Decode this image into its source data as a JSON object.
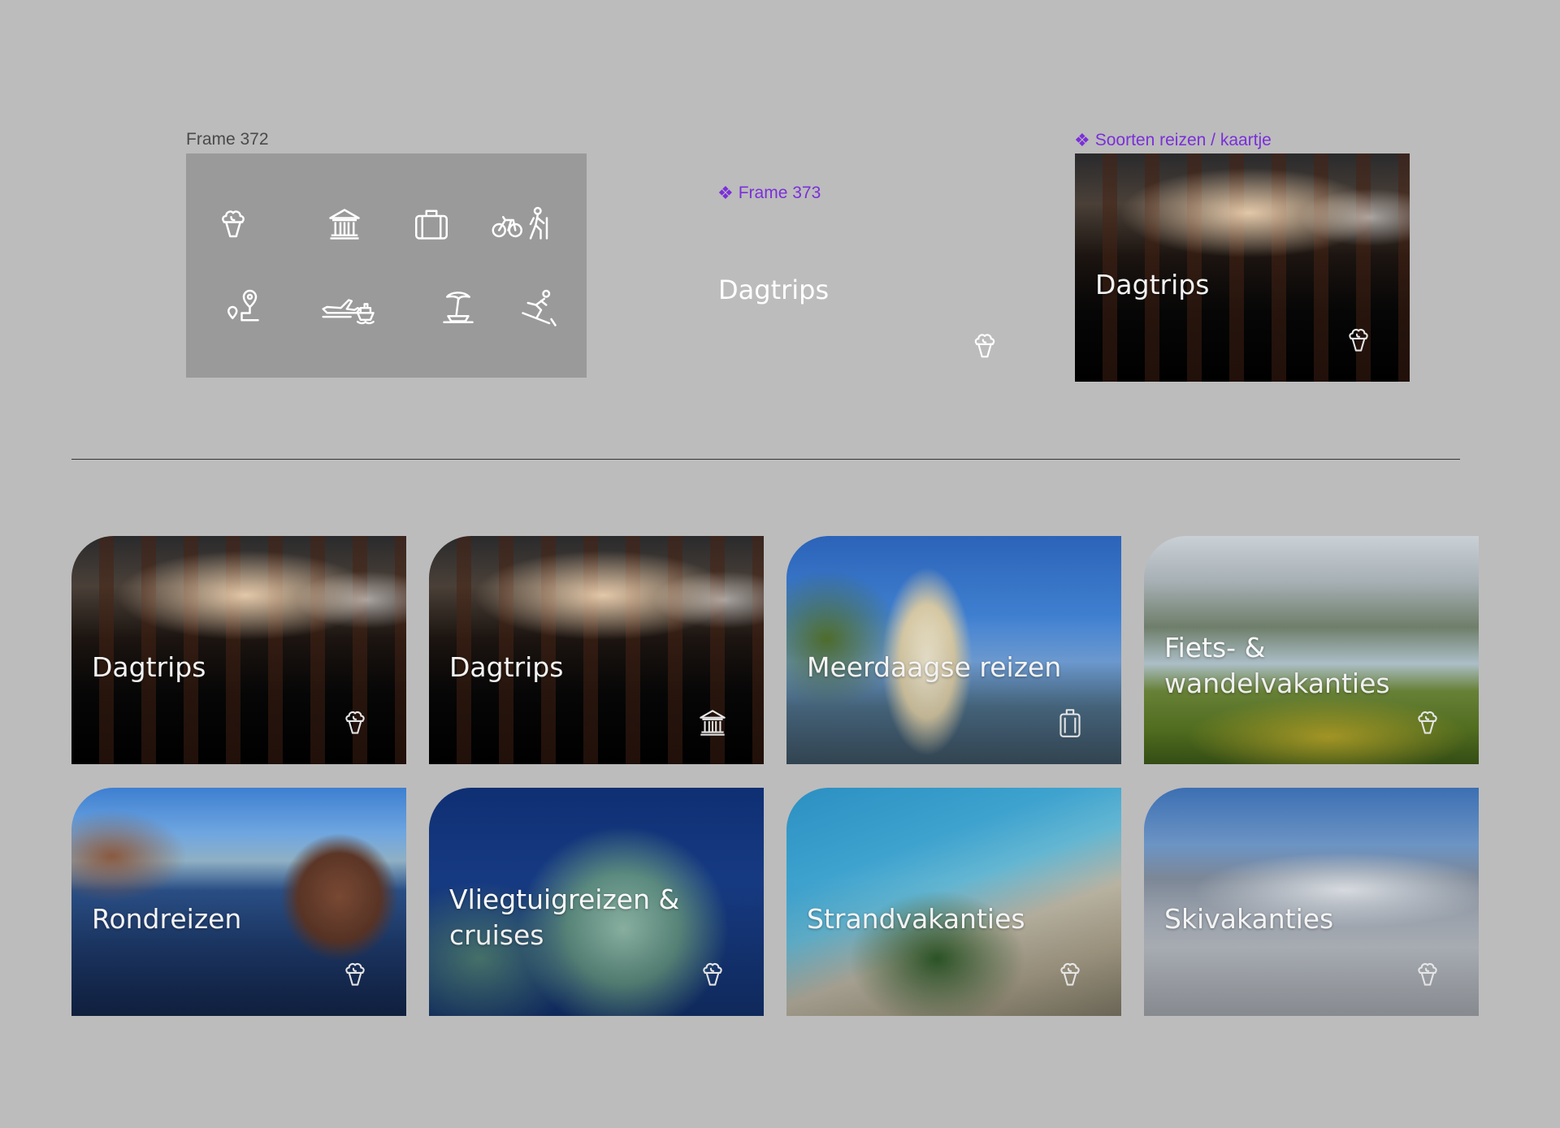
{
  "canvas": {
    "frame372_label": "Frame 372",
    "frame373_label": "Frame 373",
    "component_label": "Soorten reizen / kaartje",
    "component_glyph": "❖"
  },
  "frame372": {
    "icons": [
      "ice-cream-icon",
      "museum-icon",
      "suitcase-icon",
      "bike-hike-icon",
      "map-pin-route-icon",
      "plane-ship-icon",
      "palm-island-icon",
      "skiing-icon"
    ]
  },
  "frame373": {
    "title": "Dagtrips",
    "icon": "ice-cream-icon"
  },
  "component_card": {
    "title": "Dagtrips",
    "icon": "ice-cream-icon",
    "image": "bus-interior-photo"
  },
  "cards": [
    {
      "title": "Dagtrips",
      "icon": "ice-cream-icon",
      "image": "bus-interior-photo"
    },
    {
      "title": "Dagtrips",
      "icon": "museum-icon",
      "image": "bus-interior-photo"
    },
    {
      "title": "Meerdaagse reizen",
      "icon": "suitcase-icon",
      "image": "coastal-cliff-photo"
    },
    {
      "title": "Fiets- & wandelvakanties",
      "icon": "ice-cream-icon",
      "image": "mountain-lake-photo"
    },
    {
      "title": "Rondreizen",
      "icon": "ice-cream-icon",
      "image": "rocky-islands-photo"
    },
    {
      "title": "Vliegtuigreizen & cruises",
      "icon": "ice-cream-icon",
      "image": "statue-of-liberty-photo"
    },
    {
      "title": "Strandvakanties",
      "icon": "ice-cream-icon",
      "image": "beach-palms-photo"
    },
    {
      "title": "Skivakanties",
      "icon": "ice-cream-icon",
      "image": "snowy-mountains-photo"
    }
  ],
  "colors": {
    "canvas_bg": "#bcbcbc",
    "frame_bg": "#9a9a9a",
    "component_accent": "#7b2fd9",
    "text_light": "#ffffff"
  }
}
